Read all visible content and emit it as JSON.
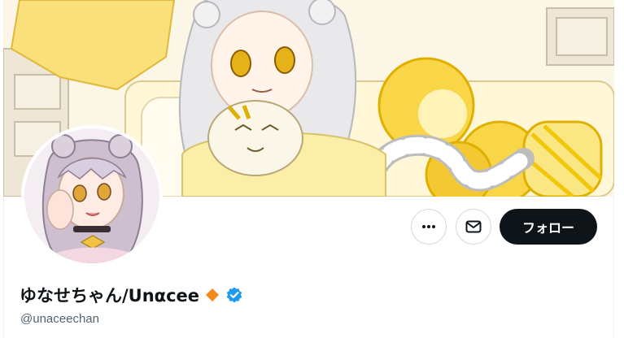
{
  "profile": {
    "display_name": "ゆなせちゃん/Unαcee",
    "handle": "@unaceechan",
    "follow_label": "フォロー"
  },
  "icons": {
    "more": "more-dots-icon",
    "message": "envelope-icon",
    "affiliate": "orange-diamond-badge-icon",
    "verified": "blue-verified-check-icon"
  },
  "colors": {
    "follow_bg": "#0f1419",
    "verified": "#1d9bf0",
    "diamond": "#f28b1c",
    "handle": "#536471",
    "banner_yellow": "#f7d84a"
  }
}
